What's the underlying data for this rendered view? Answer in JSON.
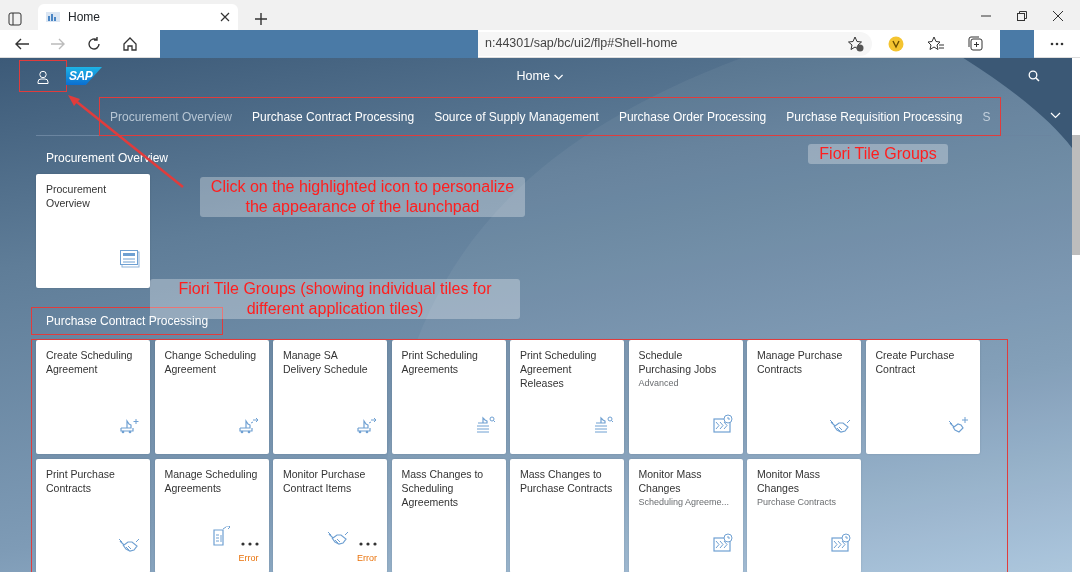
{
  "browser": {
    "tab_title": "Home",
    "url": "n:44301/sap/bc/ui2/flp#Shell-home"
  },
  "shell": {
    "logo": "SAP",
    "title": "Home",
    "user_button_highlighted": true
  },
  "group_tabs": {
    "highlighted": true,
    "items": [
      {
        "label": "Procurement Overview"
      },
      {
        "label": "Purchase Contract Processing"
      },
      {
        "label": "Source of Supply Management"
      },
      {
        "label": "Purchase Order Processing"
      },
      {
        "label": "Purchase Requisition Processing"
      },
      {
        "label": "S"
      }
    ]
  },
  "groups": [
    {
      "title": "Procurement Overview",
      "highlighted": false,
      "tiles_highlighted": false,
      "tiles": [
        {
          "title": "Procurement Overview",
          "kind": "news"
        }
      ]
    },
    {
      "title": "Purchase Contract Processing",
      "highlighted": true,
      "tiles_highlighted": true,
      "tiles": [
        {
          "title": "Create Scheduling Agreement",
          "kind": "truckplus"
        },
        {
          "title": "Change Scheduling Agreement",
          "kind": "truck"
        },
        {
          "title": "Manage SA Delivery Schedule",
          "kind": "truck"
        },
        {
          "title": "Print Scheduling Agreements",
          "kind": "trucklist"
        },
        {
          "title": "Print Scheduling Agreement Releases",
          "kind": "trucklist"
        },
        {
          "title": "Schedule Purchasing Jobs",
          "subtitle": "Advanced",
          "kind": "jobs"
        },
        {
          "title": "Manage Purchase Contracts",
          "kind": "handshake"
        },
        {
          "title": "Create Purchase Contract",
          "kind": "handshakeplus"
        },
        {
          "title": "Print Purchase Contracts",
          "kind": "handshake"
        },
        {
          "title": "Manage Scheduling Agreements",
          "kind": "document",
          "more": true,
          "footer": "Error"
        },
        {
          "title": "Monitor Purchase Contract Items",
          "kind": "handshake",
          "more": true,
          "footer": "Error"
        },
        {
          "title": "Mass Changes to Scheduling Agreements",
          "kind": "plain"
        },
        {
          "title": "Mass Changes to Purchase Contracts",
          "kind": "plain"
        },
        {
          "title": "Monitor Mass Changes",
          "subtitle": "Scheduling Agreeme...",
          "kind": "jobs"
        },
        {
          "title": "Monitor Mass Changes",
          "subtitle": "Purchase Contracts",
          "kind": "jobs"
        }
      ]
    }
  ],
  "annotations": [
    {
      "kind": "arrow"
    },
    {
      "kind": "note",
      "text": "Fiori Tile Groups"
    },
    {
      "kind": "note",
      "text": "Click on the highlighted icon to personalize the appearance of the launchpad"
    },
    {
      "kind": "note",
      "text": "Fiori Tile Groups (showing individual tiles for different application tiles)"
    }
  ]
}
